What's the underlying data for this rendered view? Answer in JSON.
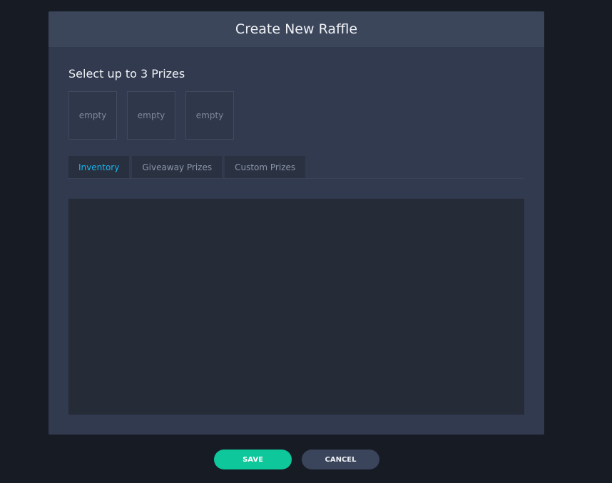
{
  "modal": {
    "title": "Create New Raffle",
    "section_title": "Select up to 3 Prizes",
    "prize_slots": [
      {
        "label": "empty"
      },
      {
        "label": "empty"
      },
      {
        "label": "empty"
      }
    ],
    "tabs": [
      {
        "label": "Inventory",
        "active": true
      },
      {
        "label": "Giveaway Prizes",
        "active": false
      },
      {
        "label": "Custom Prizes",
        "active": false
      }
    ]
  },
  "actions": {
    "save_label": "SAVE",
    "cancel_label": "CANCEL"
  },
  "colors": {
    "background": "#171b24",
    "modal": "#313a4e",
    "header": "#3b465b",
    "active_tab_text": "#18b5ee",
    "save_button": "#0ec79a",
    "cancel_button": "#3a445a"
  }
}
